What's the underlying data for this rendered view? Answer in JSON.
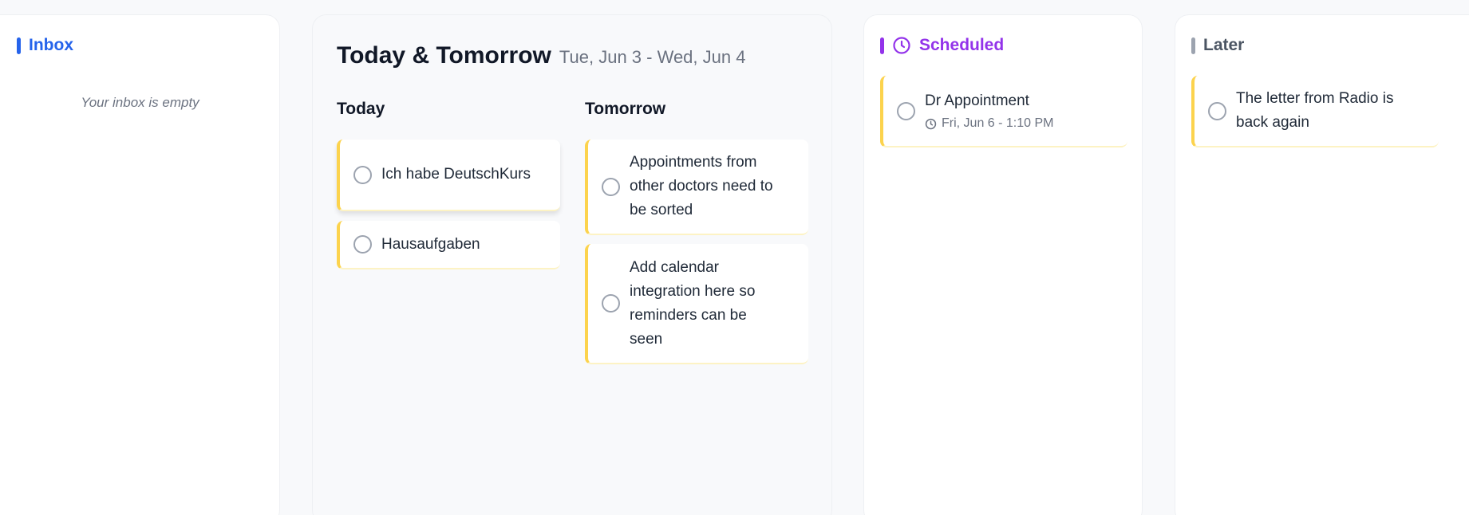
{
  "inbox": {
    "title": "Inbox",
    "empty_text": "Your inbox is empty",
    "accent": "#2563eb"
  },
  "today_tomorrow": {
    "title": "Today & Tomorrow",
    "date_range": "Tue, Jun 3 - Wed, Jun 4",
    "today": {
      "label": "Today",
      "tasks": [
        {
          "text": "Ich habe DeutschKurs"
        },
        {
          "text": "Hausaufgaben"
        }
      ]
    },
    "tomorrow": {
      "label": "Tomorrow",
      "tasks": [
        {
          "text": "Appointments from other doctors need to be sorted"
        },
        {
          "text": "Add calendar integration here so reminders can be seen"
        }
      ]
    }
  },
  "scheduled": {
    "title": "Scheduled",
    "icon": "clock-icon",
    "accent": "#9333ea",
    "tasks": [
      {
        "text": "Dr Appointment",
        "time": "Fri, Jun 6 - 1:10 PM"
      }
    ]
  },
  "later": {
    "title": "Later",
    "accent": "#9ca3af",
    "tasks": [
      {
        "text": "The letter from Radio is back again"
      }
    ]
  },
  "colors": {
    "task_accent": "#fcd34d",
    "background": "#f8f9fb"
  }
}
